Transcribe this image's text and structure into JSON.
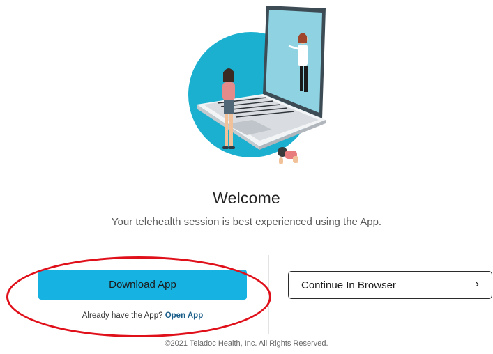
{
  "welcome": {
    "title": "Welcome",
    "subtitle": "Your telehealth session is best experienced using the App."
  },
  "actions": {
    "download_label": "Download App",
    "already_text": "Already have the App?",
    "open_app_label": "Open App",
    "continue_label": "Continue In Browser",
    "continue_icon": "chevron-right-icon"
  },
  "footer": {
    "copyright": "©2021 Teladoc Health, Inc. All Rights Reserved."
  },
  "colors": {
    "primary_button": "#16b2e1",
    "link": "#1a5e8a",
    "annotation": "#e0101b",
    "hero_circle": "#1bb0cf"
  }
}
